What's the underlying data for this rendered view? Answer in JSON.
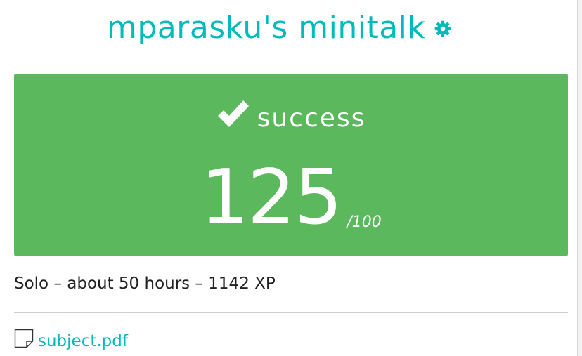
{
  "header": {
    "title": "mparasku's minitalk",
    "settings_icon": "gear-icon"
  },
  "result": {
    "status_icon": "checkmark-icon",
    "status": "success",
    "score": "125",
    "max_score": "/100",
    "color": "#5cb85c"
  },
  "meta": {
    "summary": "Solo – about 50 hours – 1142 XP"
  },
  "attachments": [
    {
      "icon": "file-icon",
      "label": "subject.pdf"
    }
  ],
  "colors": {
    "accent": "#00babc",
    "success": "#5cb85c"
  }
}
